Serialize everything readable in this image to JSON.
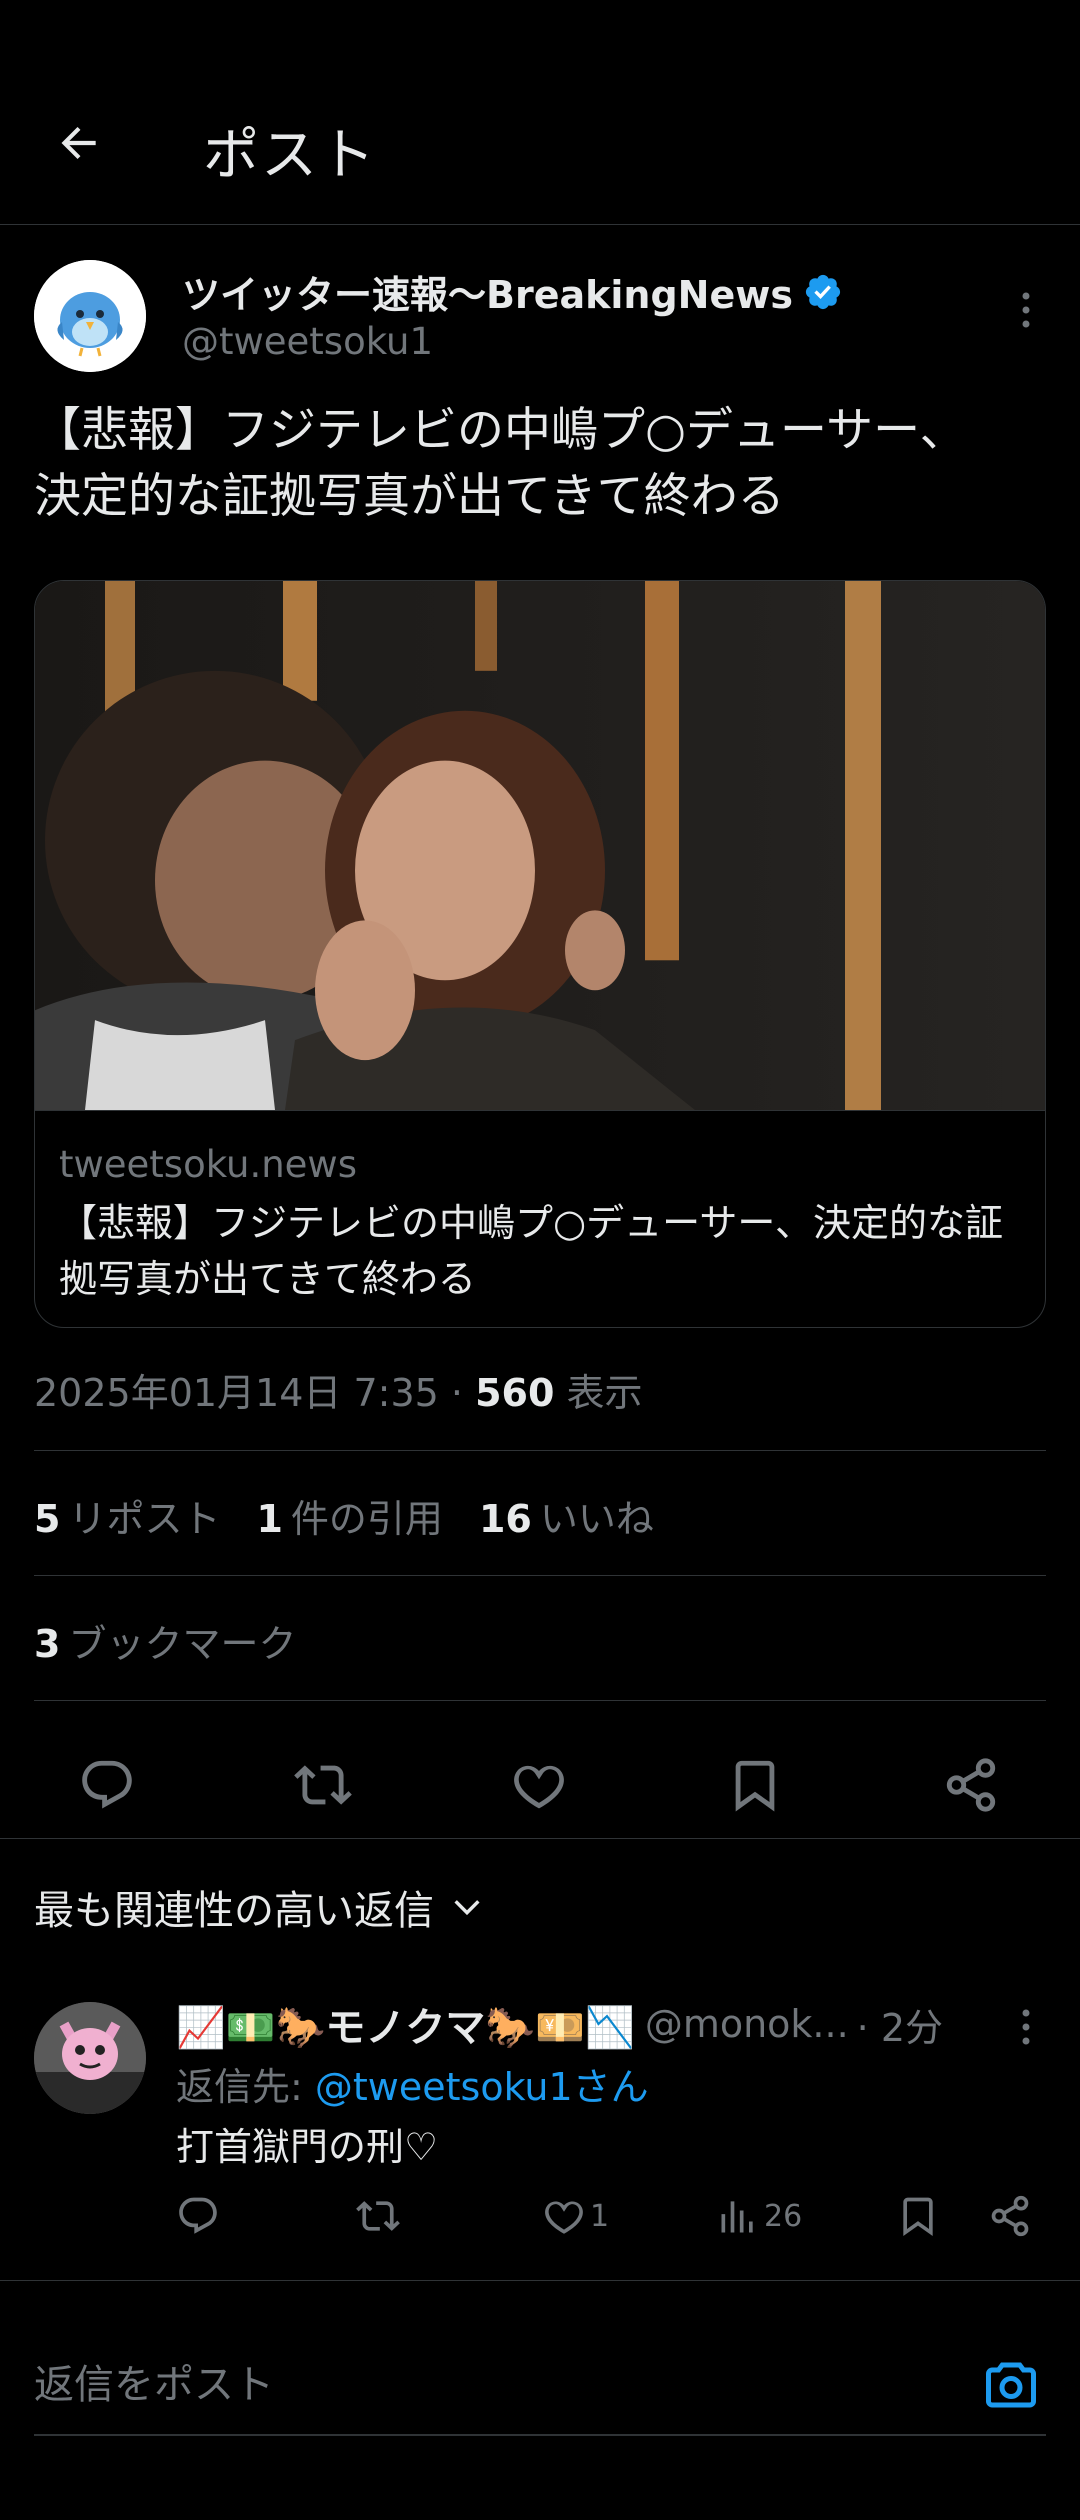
{
  "header": {
    "title": "ポスト",
    "back_icon": "arrow-left-icon"
  },
  "post": {
    "author": {
      "display_name": "ツイッター速報〜BreakingNews",
      "handle": "@tweetsoku1",
      "verified": true
    },
    "text_lines": [
      "【悲報】フジテレビの中嶋プ○デューサー、",
      "決定的な証拠写真が出てきて終わる"
    ],
    "card": {
      "domain": "tweetsoku.news",
      "title": "【悲報】フジテレビの中嶋プ○デューサー、決定的な証拠写真が出てきて終わる"
    },
    "meta": {
      "datetime": "2025年01月14日 7:35",
      "separator": " · ",
      "views": "560",
      "views_label": " 表示"
    },
    "stats": {
      "reposts": "5",
      "reposts_label": "リポスト",
      "quotes": "1",
      "quotes_label": "件の引用",
      "likes": "16",
      "likes_label": "いいね",
      "bookmarks": "3",
      "bookmarks_label": "ブックマーク"
    }
  },
  "replies_sort": {
    "label": "最も関連性の高い返信"
  },
  "reply": {
    "display_name": "📈💵🐎モノクマ🐎💴📉",
    "handle": "@monok...",
    "time": "· 2分",
    "reply_to_prefix": "返信先: ",
    "reply_to_mention": "@tweetsoku1さん",
    "text": "打首獄門の刑♡",
    "likes": "1",
    "views": "26"
  },
  "compose": {
    "placeholder": "返信をポスト"
  },
  "colors": {
    "accent": "#1d9bf0",
    "background": "#000000",
    "muted": "#71767b",
    "text": "#e7e9ea",
    "divider": "#2f3336"
  }
}
